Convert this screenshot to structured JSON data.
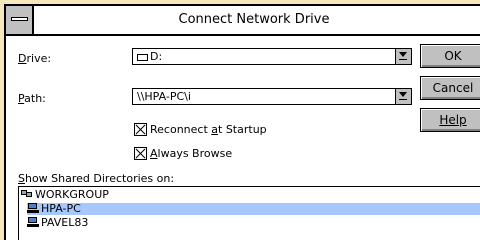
{
  "window": {
    "title": "Connect Network Drive"
  },
  "drive": {
    "label": "Drive:",
    "value": "D:"
  },
  "path": {
    "label": "Path:",
    "value": "\\\\HPA-PC\\i"
  },
  "options": {
    "reconnect": {
      "label": "Reconnect at Startup",
      "checked": true
    },
    "always_browse": {
      "label": "Always Browse",
      "checked": true
    }
  },
  "buttons": {
    "ok": "OK",
    "cancel": "Cancel",
    "help": "Help"
  },
  "shared": {
    "label": "Show Shared Directories on:",
    "items": [
      {
        "label": "WORKGROUP",
        "icon": "workgroup-icon",
        "selected": false
      },
      {
        "label": "HPA-PC",
        "icon": "computer-icon",
        "selected": true
      },
      {
        "label": "PAVEL83",
        "icon": "computer-icon",
        "selected": false
      }
    ]
  }
}
